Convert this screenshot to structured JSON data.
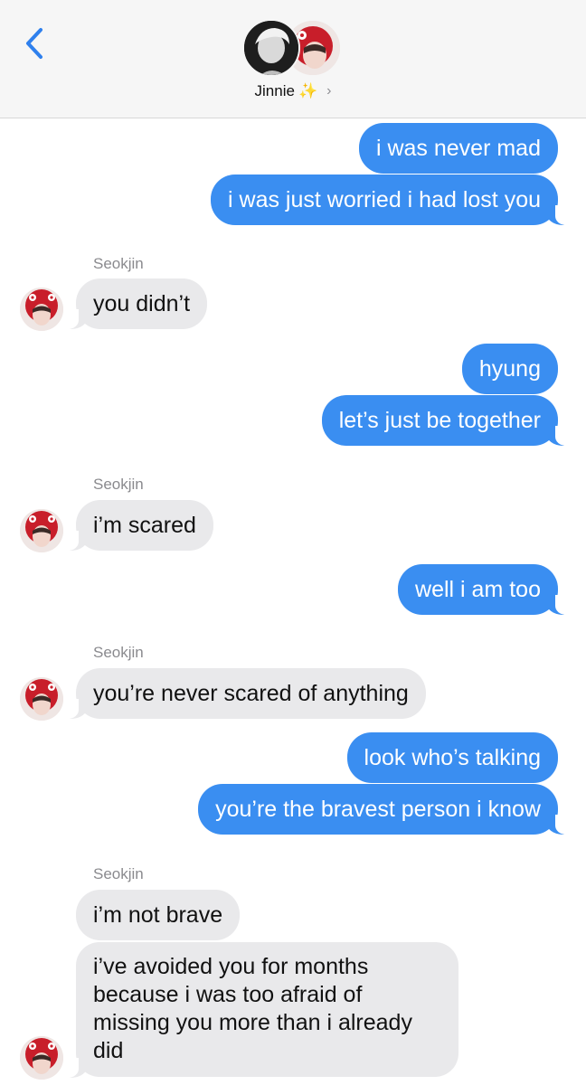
{
  "header": {
    "contact_name": "Jinnie",
    "sparkle": "✨",
    "chevron": "›",
    "back_icon": "chevron-left-icon"
  },
  "colors": {
    "outgoing_bubble": "#3a8ef1",
    "incoming_bubble": "#e9e9eb",
    "accent": "#2f80ed"
  },
  "messages": [
    {
      "from": "me",
      "text": "i was never mad"
    },
    {
      "from": "me",
      "text": "i was just worried i had lost you"
    },
    {
      "from": "them",
      "sender": "Seokjin",
      "text": "you didn’t"
    },
    {
      "from": "me",
      "text": "hyung"
    },
    {
      "from": "me",
      "text": "let’s just be together"
    },
    {
      "from": "them",
      "sender": "Seokjin",
      "text": "i’m scared"
    },
    {
      "from": "me",
      "text": "well i am too"
    },
    {
      "from": "them",
      "sender": "Seokjin",
      "text": "you’re never scared of anything"
    },
    {
      "from": "me",
      "text": "look who’s talking"
    },
    {
      "from": "me",
      "text": "you’re the bravest person i know"
    },
    {
      "from": "them",
      "sender": "Seokjin",
      "text": "i’m not brave"
    },
    {
      "from": "them",
      "text": "i’ve avoided you for months because i was too afraid of missing you more than i already did"
    }
  ]
}
